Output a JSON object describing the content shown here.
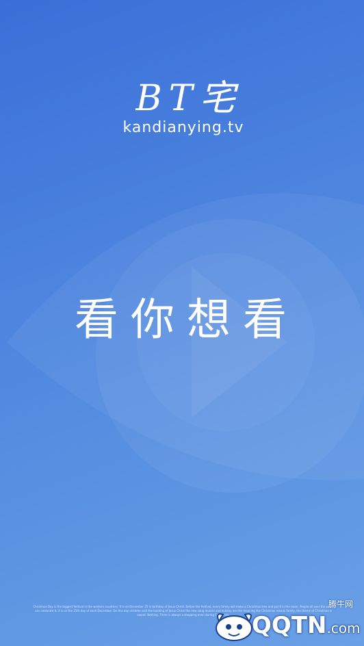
{
  "logo": {
    "title": "BT宅",
    "domain": "kandianying.tv"
  },
  "slogan": "看你想看",
  "fine_print": "Christmas Day is the biggest festival in the western countries. It is on December 25 in birthday of Jesus Christ. Before the festival, every family will make a Christmas tree and put it in the room. People all over the world can celebrate it, it is on the 25th day of each December. On this day children visit the building of Jesus Christ the new song muscle and holiday are the meaning like Christmas means family, the theme of Christmas is sound. Nothing. There is always a shopping even during Christmas.",
  "watermark": {
    "brand": "QQTN",
    "suffix": ".com",
    "cn_label": "腾牛网",
    "icon": "qqtn-mascot-icon"
  },
  "colors": {
    "background_top": "#3a6fd8",
    "background_bottom": "#6aa0e6",
    "text": "#ffffff"
  }
}
